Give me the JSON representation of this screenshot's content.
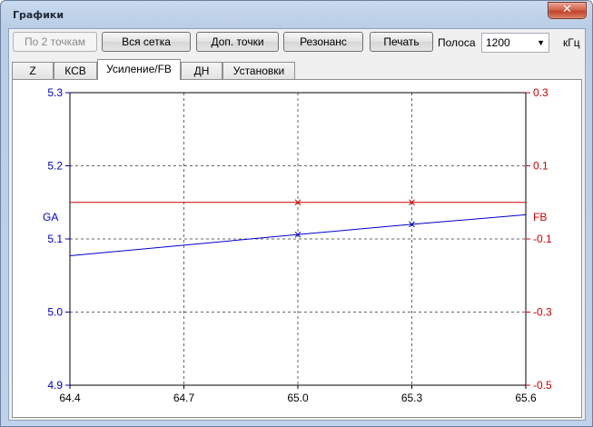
{
  "window": {
    "title": "Графики",
    "close_glyph": "✕"
  },
  "toolbar": {
    "btn_two_points": "По 2 точкам",
    "btn_all_grid": "Вся сетка",
    "btn_extra_points": "Доп. точки",
    "btn_resonance": "Резонанс",
    "btn_print": "Печать",
    "band_label": "Полоса",
    "band_value": "1200",
    "band_unit": "кГц"
  },
  "tabs": [
    {
      "label": "Z",
      "active": false
    },
    {
      "label": "КСВ",
      "active": false
    },
    {
      "label": "Усиление/FB",
      "active": true
    },
    {
      "label": "ДН",
      "active": false
    },
    {
      "label": "Установки",
      "active": false
    }
  ],
  "colors": {
    "ga": "#0000cc",
    "fb": "#cc0000",
    "grid": "#666666",
    "axis_text": "#000000"
  },
  "chart_data": {
    "type": "line",
    "x_ticks": [
      "64.4",
      "64.7",
      "65.0",
      "65.3",
      "65.6"
    ],
    "xlim": [
      64.4,
      65.6
    ],
    "left_axis": {
      "label": "GA",
      "ticks": [
        "5.3",
        "5.2",
        "5.1",
        "5.0",
        "4.9"
      ],
      "ylim": [
        4.9,
        5.3
      ]
    },
    "right_axis": {
      "label": "FB",
      "ticks": [
        "0.3",
        "0.1",
        "-0.1",
        "-0.3",
        "-0.5"
      ],
      "ylim": [
        -0.5,
        0.3
      ]
    },
    "grid": true,
    "series": [
      {
        "name": "GA",
        "axis": "left",
        "x": [
          64.4,
          65.0,
          65.3,
          65.6
        ],
        "y": [
          5.077,
          5.106,
          5.12,
          5.133
        ],
        "markers_x": [
          65.0,
          65.3
        ]
      },
      {
        "name": "FB",
        "axis": "right",
        "x": [
          64.4,
          65.0,
          65.3,
          65.6
        ],
        "y": [
          0.0,
          0.0,
          0.0,
          0.0
        ],
        "markers_x": [
          65.0,
          65.3
        ]
      }
    ]
  }
}
